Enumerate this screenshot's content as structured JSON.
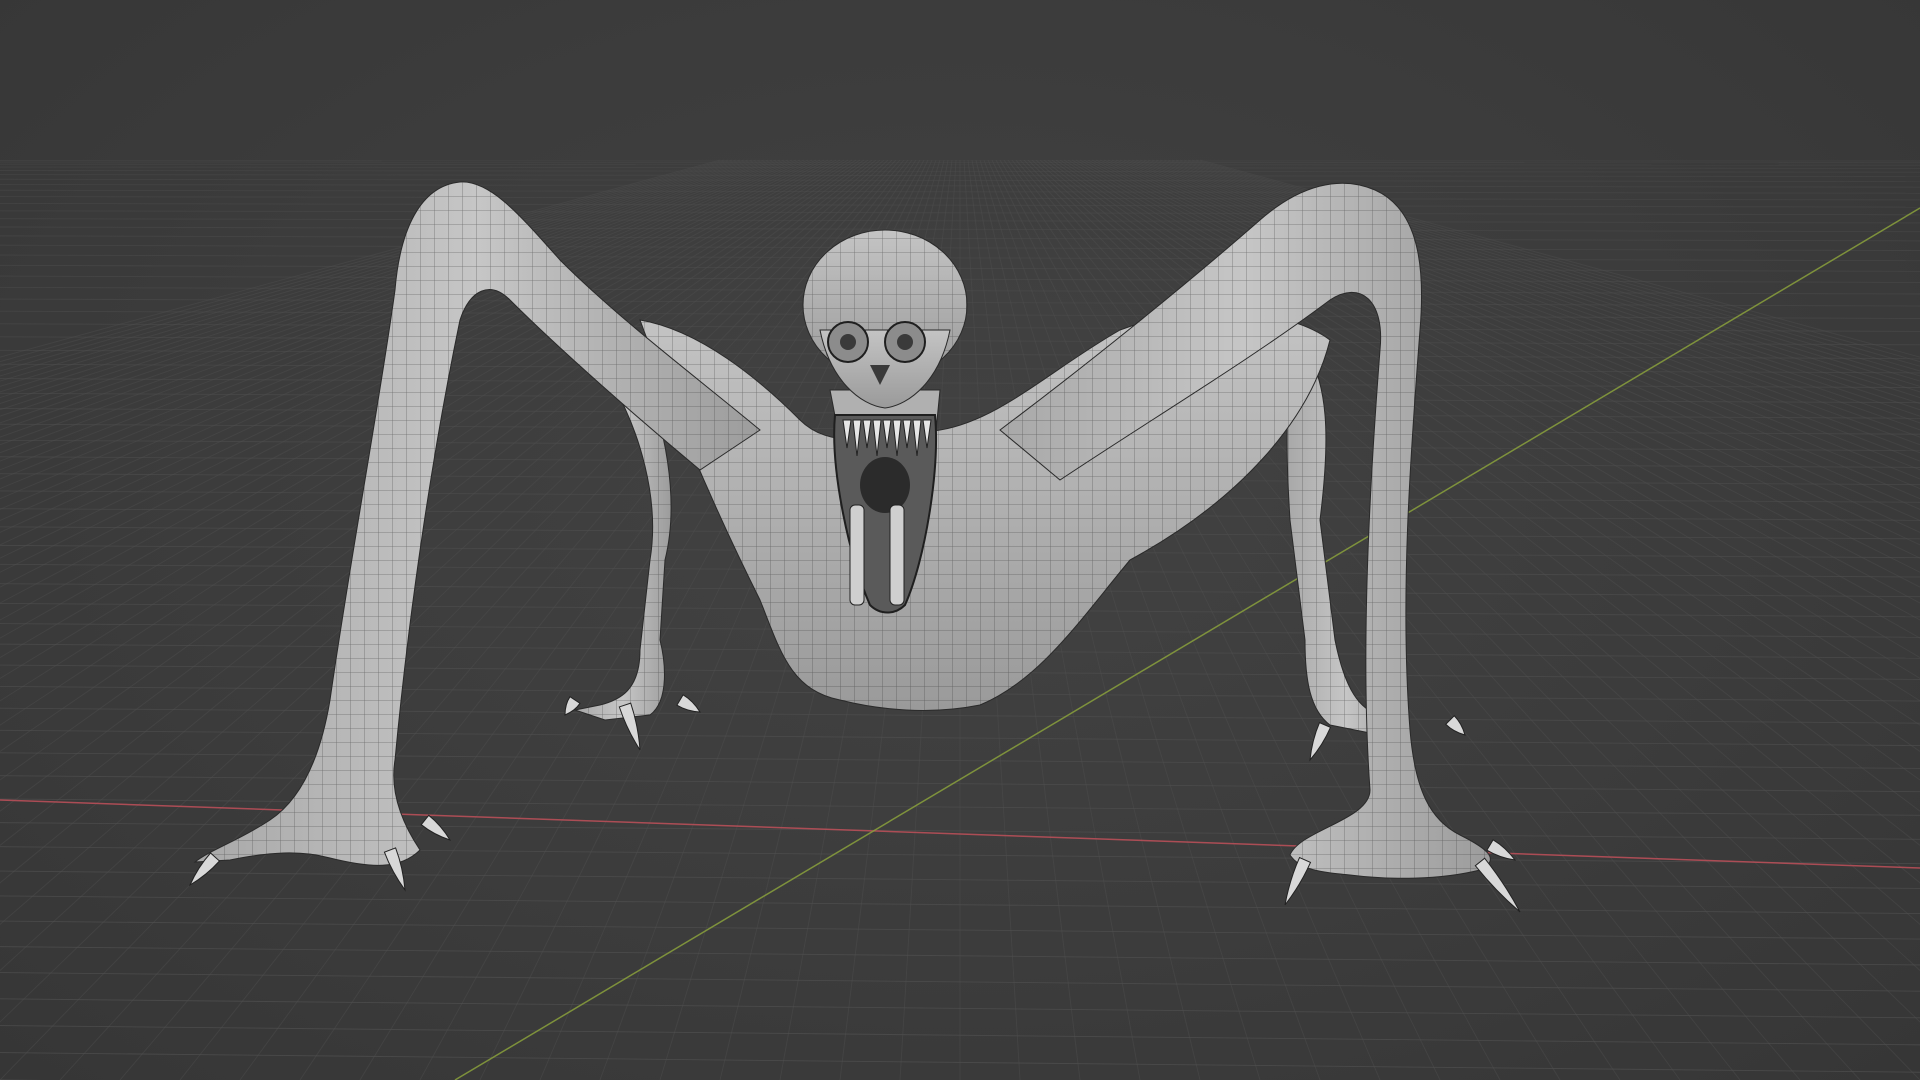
{
  "viewport": {
    "mode": "3d-perspective",
    "background_color": "#3d3d3d",
    "grid_color": "#505050",
    "x_axis_color": "#c0505a",
    "y_axis_color": "#8aa13c",
    "mesh_color": "#b4b4b4",
    "wireframe_color": "#2a2a2a",
    "claw_color": "#d8d8d8"
  },
  "model": {
    "icon": "mesh-creature-icon",
    "limbs": 4,
    "display": "solid-with-wireframe"
  }
}
